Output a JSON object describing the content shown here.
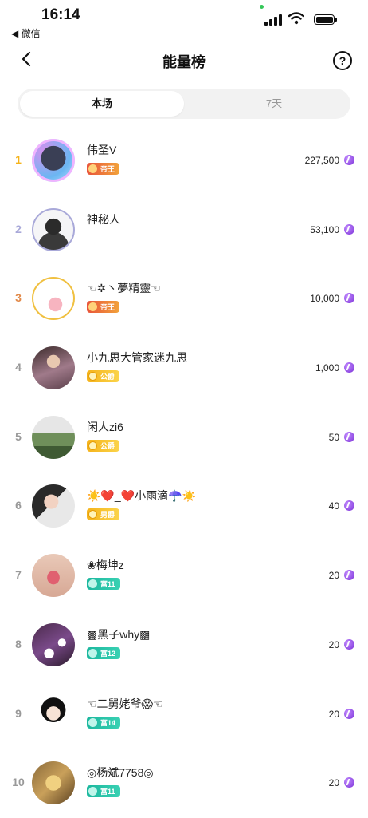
{
  "status": {
    "time": "16:14",
    "back_app": "◀ 微信"
  },
  "header": {
    "title": "能量榜",
    "help": "?"
  },
  "tabs": [
    {
      "label": "本场",
      "active": true
    },
    {
      "label": "7天",
      "active": false
    }
  ],
  "rank_colors": {
    "1": "#f5b31b",
    "2": "#a9a9d9",
    "3": "#e28a4a",
    "default": "#999999"
  },
  "rows": [
    {
      "rank": "1",
      "name": "伟圣V",
      "badge": "帝王",
      "badge_type": "emperor",
      "score": "227,500"
    },
    {
      "rank": "2",
      "name": "神秘人",
      "badge": "",
      "badge_type": "",
      "score": "53,100"
    },
    {
      "rank": "3",
      "name": "☜✲丶夢精靈☜",
      "badge": "帝王",
      "badge_type": "emperor",
      "score": "10,000"
    },
    {
      "rank": "4",
      "name": "小九思大管家迷九思",
      "badge": "公爵",
      "badge_type": "duke",
      "score": "1,000"
    },
    {
      "rank": "5",
      "name": "闲人zi6",
      "badge": "公爵",
      "badge_type": "duke",
      "score": "50"
    },
    {
      "rank": "6",
      "name": "☀️❤️_❤️小雨滴☂️☀️",
      "badge": "男爵",
      "badge_type": "baron",
      "score": "40"
    },
    {
      "rank": "7",
      "name": "❀梅坤z",
      "badge": "富11",
      "badge_type": "rich",
      "score": "20"
    },
    {
      "rank": "8",
      "name": "▩黑子why▩",
      "badge": "富12",
      "badge_type": "rich",
      "score": "20"
    },
    {
      "rank": "9",
      "name": "☜二舅姥爷😱☜",
      "badge": "富14",
      "badge_type": "rich",
      "score": "20"
    },
    {
      "rank": "10",
      "name": "◎杨斌7758◎",
      "badge": "富11",
      "badge_type": "rich",
      "score": "20"
    }
  ]
}
